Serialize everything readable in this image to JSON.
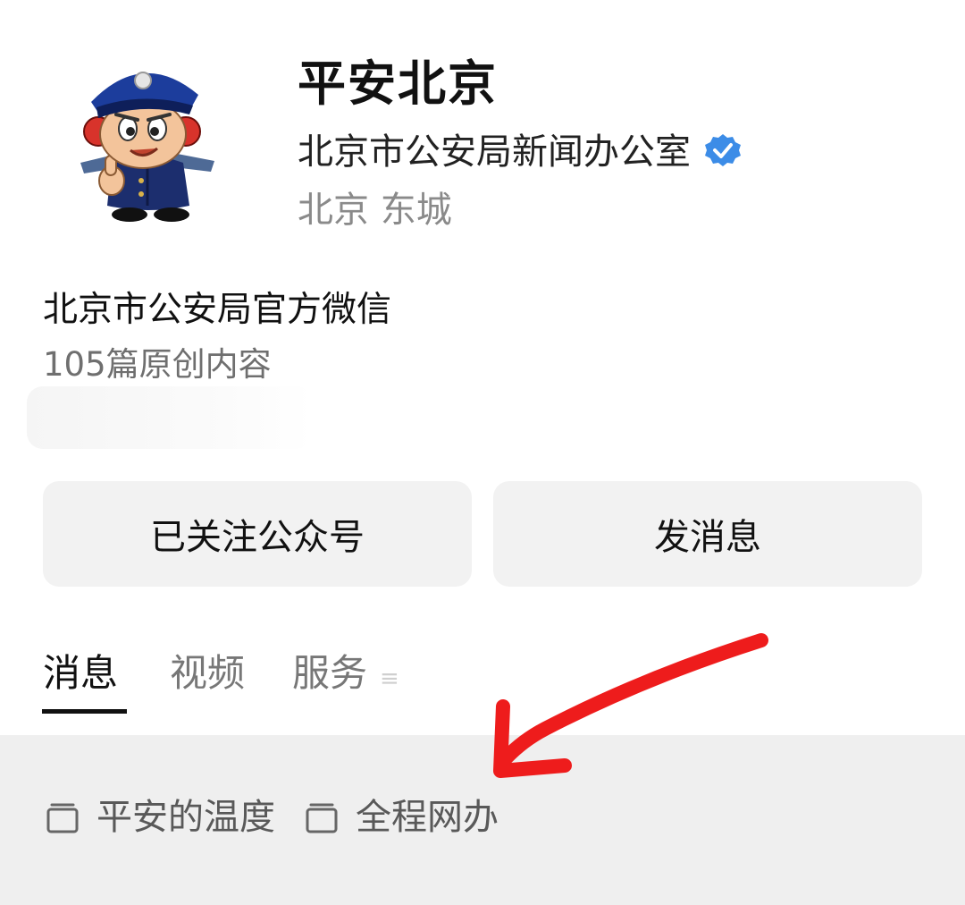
{
  "profile": {
    "name": "平安北京",
    "org": "北京市公安局新闻办公室",
    "region": "北京 东城",
    "description": "北京市公安局官方微信",
    "article_count": "105篇原创内容"
  },
  "buttons": {
    "follow_label": "已关注公众号",
    "message_label": "发消息"
  },
  "tabs": [
    {
      "label": "消息",
      "active": true
    },
    {
      "label": "视频",
      "active": false
    },
    {
      "label": "服务",
      "active": false
    }
  ],
  "menu": [
    {
      "label": "平安的温度",
      "icon": "folder-icon"
    },
    {
      "label": "全程网办",
      "icon": "folder-icon"
    }
  ],
  "colors": {
    "verified": "#3c8ce7",
    "annotation_arrow": "#ee1c1c",
    "button_bg": "#f2f2f2",
    "menu_bg": "#efefef"
  }
}
